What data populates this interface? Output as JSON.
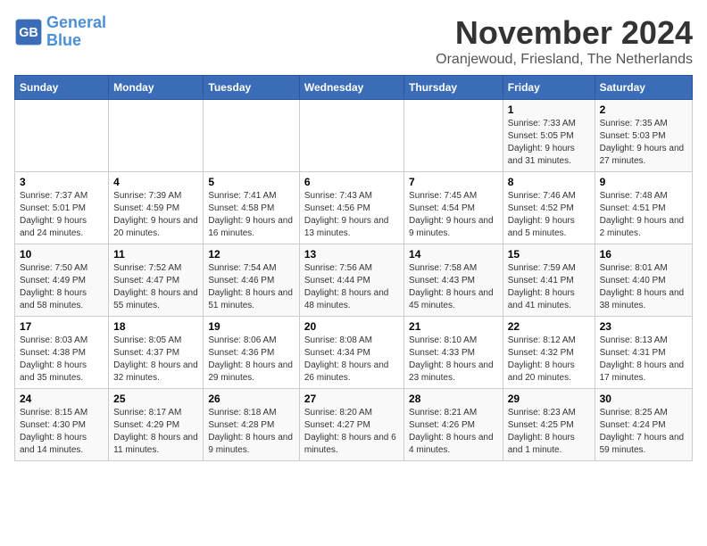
{
  "header": {
    "logo_line1": "General",
    "logo_line2": "Blue",
    "month_title": "November 2024",
    "subtitle": "Oranjewoud, Friesland, The Netherlands"
  },
  "weekdays": [
    "Sunday",
    "Monday",
    "Tuesday",
    "Wednesday",
    "Thursday",
    "Friday",
    "Saturday"
  ],
  "weeks": [
    [
      {
        "day": "",
        "info": ""
      },
      {
        "day": "",
        "info": ""
      },
      {
        "day": "",
        "info": ""
      },
      {
        "day": "",
        "info": ""
      },
      {
        "day": "",
        "info": ""
      },
      {
        "day": "1",
        "info": "Sunrise: 7:33 AM\nSunset: 5:05 PM\nDaylight: 9 hours and 31 minutes."
      },
      {
        "day": "2",
        "info": "Sunrise: 7:35 AM\nSunset: 5:03 PM\nDaylight: 9 hours and 27 minutes."
      }
    ],
    [
      {
        "day": "3",
        "info": "Sunrise: 7:37 AM\nSunset: 5:01 PM\nDaylight: 9 hours and 24 minutes."
      },
      {
        "day": "4",
        "info": "Sunrise: 7:39 AM\nSunset: 4:59 PM\nDaylight: 9 hours and 20 minutes."
      },
      {
        "day": "5",
        "info": "Sunrise: 7:41 AM\nSunset: 4:58 PM\nDaylight: 9 hours and 16 minutes."
      },
      {
        "day": "6",
        "info": "Sunrise: 7:43 AM\nSunset: 4:56 PM\nDaylight: 9 hours and 13 minutes."
      },
      {
        "day": "7",
        "info": "Sunrise: 7:45 AM\nSunset: 4:54 PM\nDaylight: 9 hours and 9 minutes."
      },
      {
        "day": "8",
        "info": "Sunrise: 7:46 AM\nSunset: 4:52 PM\nDaylight: 9 hours and 5 minutes."
      },
      {
        "day": "9",
        "info": "Sunrise: 7:48 AM\nSunset: 4:51 PM\nDaylight: 9 hours and 2 minutes."
      }
    ],
    [
      {
        "day": "10",
        "info": "Sunrise: 7:50 AM\nSunset: 4:49 PM\nDaylight: 8 hours and 58 minutes."
      },
      {
        "day": "11",
        "info": "Sunrise: 7:52 AM\nSunset: 4:47 PM\nDaylight: 8 hours and 55 minutes."
      },
      {
        "day": "12",
        "info": "Sunrise: 7:54 AM\nSunset: 4:46 PM\nDaylight: 8 hours and 51 minutes."
      },
      {
        "day": "13",
        "info": "Sunrise: 7:56 AM\nSunset: 4:44 PM\nDaylight: 8 hours and 48 minutes."
      },
      {
        "day": "14",
        "info": "Sunrise: 7:58 AM\nSunset: 4:43 PM\nDaylight: 8 hours and 45 minutes."
      },
      {
        "day": "15",
        "info": "Sunrise: 7:59 AM\nSunset: 4:41 PM\nDaylight: 8 hours and 41 minutes."
      },
      {
        "day": "16",
        "info": "Sunrise: 8:01 AM\nSunset: 4:40 PM\nDaylight: 8 hours and 38 minutes."
      }
    ],
    [
      {
        "day": "17",
        "info": "Sunrise: 8:03 AM\nSunset: 4:38 PM\nDaylight: 8 hours and 35 minutes."
      },
      {
        "day": "18",
        "info": "Sunrise: 8:05 AM\nSunset: 4:37 PM\nDaylight: 8 hours and 32 minutes."
      },
      {
        "day": "19",
        "info": "Sunrise: 8:06 AM\nSunset: 4:36 PM\nDaylight: 8 hours and 29 minutes."
      },
      {
        "day": "20",
        "info": "Sunrise: 8:08 AM\nSunset: 4:34 PM\nDaylight: 8 hours and 26 minutes."
      },
      {
        "day": "21",
        "info": "Sunrise: 8:10 AM\nSunset: 4:33 PM\nDaylight: 8 hours and 23 minutes."
      },
      {
        "day": "22",
        "info": "Sunrise: 8:12 AM\nSunset: 4:32 PM\nDaylight: 8 hours and 20 minutes."
      },
      {
        "day": "23",
        "info": "Sunrise: 8:13 AM\nSunset: 4:31 PM\nDaylight: 8 hours and 17 minutes."
      }
    ],
    [
      {
        "day": "24",
        "info": "Sunrise: 8:15 AM\nSunset: 4:30 PM\nDaylight: 8 hours and 14 minutes."
      },
      {
        "day": "25",
        "info": "Sunrise: 8:17 AM\nSunset: 4:29 PM\nDaylight: 8 hours and 11 minutes."
      },
      {
        "day": "26",
        "info": "Sunrise: 8:18 AM\nSunset: 4:28 PM\nDaylight: 8 hours and 9 minutes."
      },
      {
        "day": "27",
        "info": "Sunrise: 8:20 AM\nSunset: 4:27 PM\nDaylight: 8 hours and 6 minutes."
      },
      {
        "day": "28",
        "info": "Sunrise: 8:21 AM\nSunset: 4:26 PM\nDaylight: 8 hours and 4 minutes."
      },
      {
        "day": "29",
        "info": "Sunrise: 8:23 AM\nSunset: 4:25 PM\nDaylight: 8 hours and 1 minute."
      },
      {
        "day": "30",
        "info": "Sunrise: 8:25 AM\nSunset: 4:24 PM\nDaylight: 7 hours and 59 minutes."
      }
    ]
  ]
}
